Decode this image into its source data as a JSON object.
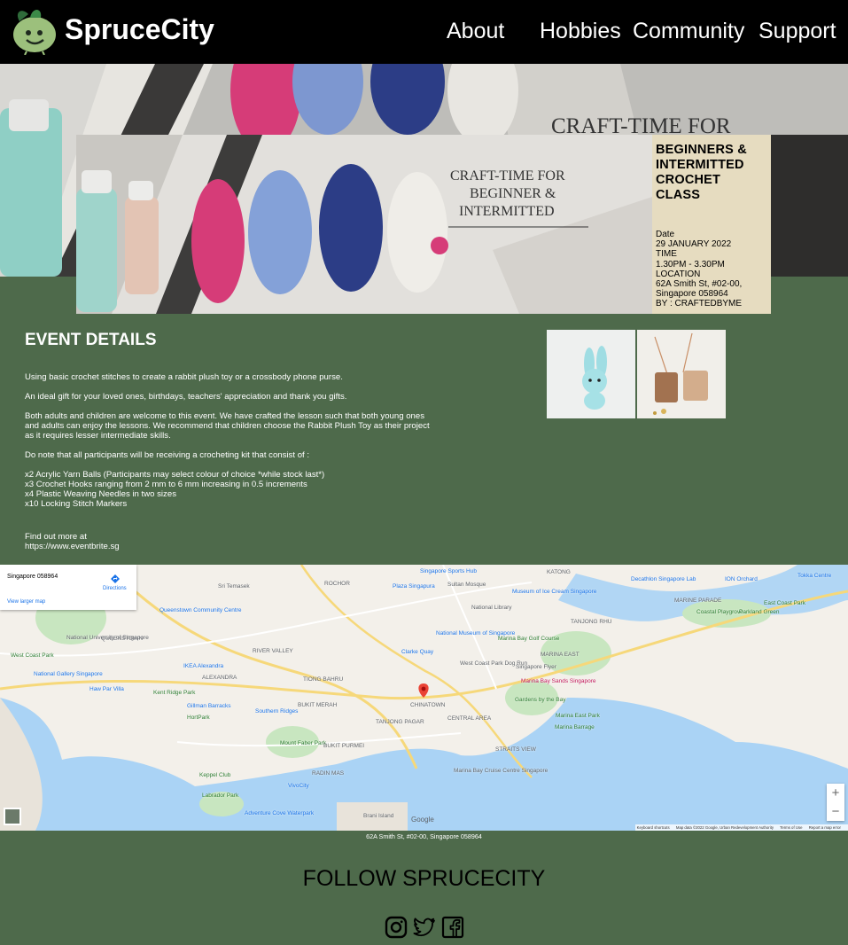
{
  "header": {
    "brand": "SpruceCity",
    "nav": [
      "About",
      "Hobbies",
      "Community",
      "Support"
    ]
  },
  "hero": {
    "bg_caption": "CRAFT-TIME FOR",
    "banner_caption": [
      "CRAFT-TIME FOR",
      "BEGINNER &",
      "INTERMITTED"
    ],
    "info": {
      "title": [
        "BEGINNERS &",
        "INTERMITTED",
        "CROCHET CLASS"
      ],
      "date_label": "Date",
      "date": "29 JANUARY 2022",
      "time_label": "TIME",
      "time": "1.30PM - 3.30PM",
      "location_label": "LOCATION",
      "location_1": "62A Smith St, #02-00,",
      "location_2": "Singapore 058964",
      "by": "BY : CRAFTEDBYME"
    }
  },
  "event": {
    "heading": "EVENT DETAILS",
    "paragraphs": [
      "Using basic crochet stitches to create a rabbit plush toy or a crossbody phone purse.",
      "An ideal gift for your loved ones, birthdays, teachers' appreciation and thank you gifts.",
      "Both adults and children are welcome to this event. We have crafted the lesson such that both young ones and adults can enjoy the lessons. We recommend that children choose the Rabbit Plush Toy as their project as it requires lesser intermediate skills.",
      "Do note that all participants will be receiving a crocheting kit that consist of :"
    ],
    "kit": [
      "x2 Acrylic Yarn Balls (Participants may select colour of choice *while stock last*)",
      "x3 Crochet Hooks ranging from 2 mm to 6 mm increasing in 0.5 increments",
      "x4 Plastic Weaving Needles in two sizes",
      "x10 Locking Stitch Markers"
    ],
    "find_out": "Find out more at",
    "link": "https://www.eventbrite.sg"
  },
  "map": {
    "card_address": "Singapore 058964",
    "directions": "Directions",
    "view_larger": "View larger map",
    "zoom_in": "+",
    "zoom_out": "−",
    "google": "Google",
    "attribution": [
      "Keyboard shortcuts",
      "Map data ©2022 Google, Urban Redevelopment Authority",
      "Terms of Use",
      "Report a map error"
    ],
    "labels": [
      {
        "t": "Singapore 058964",
        "c": "#000"
      },
      {
        "t": "Tokka Centre",
        "c": "#1a73e8"
      },
      {
        "t": "Singapore Sports Hub",
        "c": "#1a73e8"
      },
      {
        "t": "KATONG",
        "c": "#5f6368"
      },
      {
        "t": "ION Orchard",
        "c": "#1a73e8"
      },
      {
        "t": "ROCHOR",
        "c": "#5f6368"
      },
      {
        "t": "Sultan Mosque",
        "c": "#5f6368"
      },
      {
        "t": "Museum of Ice Cream Singapore",
        "c": "#1a73e8"
      },
      {
        "t": "Sri Temasek",
        "c": "#5f6368"
      },
      {
        "t": "Plaza Singapura",
        "c": "#1a73e8"
      },
      {
        "t": "Decathlon Singapore Lab",
        "c": "#1a73e8"
      },
      {
        "t": "MARINE PARADE",
        "c": "#5f6368"
      },
      {
        "t": "East Coast Park",
        "c": "#2e7d32"
      },
      {
        "t": "Queenstown Community Centre",
        "c": "#1a73e8"
      },
      {
        "t": "National Library",
        "c": "#5f6368"
      },
      {
        "t": "Coastal Playgrove",
        "c": "#2e7d32"
      },
      {
        "t": "Parkland Green",
        "c": "#2e7d32"
      },
      {
        "t": "QUEENSTOWN",
        "c": "#5f6368"
      },
      {
        "t": "National University of Singapore",
        "c": "#5f6368"
      },
      {
        "t": "National Museum of Singapore",
        "c": "#1a73e8"
      },
      {
        "t": "TANJONG RHU",
        "c": "#5f6368"
      },
      {
        "t": "RIVER VALLEY",
        "c": "#5f6368"
      },
      {
        "t": "Marina Bay Golf Course",
        "c": "#2e7d32"
      },
      {
        "t": "Clarke Quay",
        "c": "#1a73e8"
      },
      {
        "t": "West Coast Park",
        "c": "#2e7d32"
      },
      {
        "t": "MARINA EAST",
        "c": "#5f6368"
      },
      {
        "t": "IKEA Alexandra",
        "c": "#1a73e8"
      },
      {
        "t": "ALEXANDRA",
        "c": "#5f6368"
      },
      {
        "t": "TIONG BAHRU",
        "c": "#5f6368"
      },
      {
        "t": "National Gallery Singapore",
        "c": "#1a73e8"
      },
      {
        "t": "West Coast Park Dog Run",
        "c": "#5f6368"
      },
      {
        "t": "Singapore Flyer",
        "c": "#5f6368"
      },
      {
        "t": "Haw Par Villa",
        "c": "#1a73e8"
      },
      {
        "t": "Marina Bay Sands Singapore",
        "c": "#c2185b"
      },
      {
        "t": "Kent Ridge Park",
        "c": "#2e7d32"
      },
      {
        "t": "BUKIT MERAH",
        "c": "#5f6368"
      },
      {
        "t": "CHINATOWN",
        "c": "#5f6368"
      },
      {
        "t": "Gardens by the Bay",
        "c": "#2e7d32"
      },
      {
        "t": "Marina East Park",
        "c": "#2e7d32"
      },
      {
        "t": "Gillman Barracks",
        "c": "#1a73e8"
      },
      {
        "t": "Southern Ridges",
        "c": "#1a73e8"
      },
      {
        "t": "CENTRAL AREA",
        "c": "#5f6368"
      },
      {
        "t": "Marina Barrage",
        "c": "#2e7d32"
      },
      {
        "t": "HortPark",
        "c": "#2e7d32"
      },
      {
        "t": "TANJONG PAGAR",
        "c": "#5f6368"
      },
      {
        "t": "Mount Faber Park",
        "c": "#2e7d32"
      },
      {
        "t": "BUKIT PURMEI",
        "c": "#5f6368"
      },
      {
        "t": "STRAITS VIEW",
        "c": "#5f6368"
      },
      {
        "t": "Keppel Club",
        "c": "#2e7d32"
      },
      {
        "t": "RADIN MAS",
        "c": "#5f6368"
      },
      {
        "t": "Marina Bay Cruise Centre Singapore",
        "c": "#5f6368"
      },
      {
        "t": "VivoCity",
        "c": "#1a73e8"
      },
      {
        "t": "Labrador Park",
        "c": "#2e7d32"
      },
      {
        "t": "Adventure Cove Waterpark",
        "c": "#1a73e8"
      },
      {
        "t": "Brani Island",
        "c": "#5f6368"
      }
    ]
  },
  "map_caption": "62A Smith St, #02-00, Singapore 058964",
  "footer": {
    "follow": "FOLLOW SPRUCECITY",
    "socials": [
      "instagram",
      "twitter",
      "facebook"
    ]
  }
}
